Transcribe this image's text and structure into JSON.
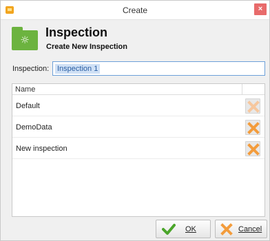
{
  "window": {
    "title": "Create",
    "close_glyph": "×"
  },
  "header": {
    "title": "Inspection",
    "subtitle": "Create New Inspection",
    "icon": "folder-sun-icon",
    "sun_glyph": "☼"
  },
  "form": {
    "label": "Inspection:",
    "value": "Inspection 1"
  },
  "list": {
    "column_header": "Name",
    "rows": [
      {
        "name": "Default",
        "delete_enabled": false
      },
      {
        "name": "DemoData",
        "delete_enabled": true
      },
      {
        "name": "New inspection",
        "delete_enabled": true
      }
    ]
  },
  "buttons": {
    "ok_label": "OK",
    "cancel_label": "Cancel"
  },
  "colors": {
    "accent_green": "#6cb33f",
    "delete_orange": "#f39c3c",
    "delete_orange_disabled": "#f6c79e",
    "ok_check_green": "#4aa52a",
    "close_red": "#e86b6b",
    "selection_blue": "#cfe0f5"
  }
}
